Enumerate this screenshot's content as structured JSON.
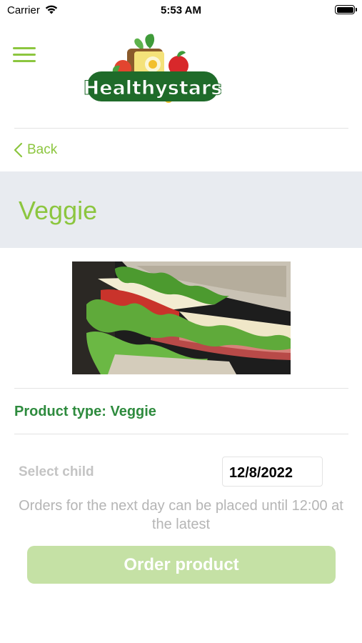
{
  "status_bar": {
    "carrier": "Carrier",
    "time": "5:53 AM"
  },
  "header": {
    "logo_text": "Healthystars"
  },
  "nav": {
    "back_label": "Back"
  },
  "page": {
    "title": "Veggie"
  },
  "product": {
    "type_label": "Product type: Veggie",
    "image_icon": "sandwich-photo"
  },
  "order_form": {
    "select_child_label": "Select child",
    "date_value": "12/8/2022",
    "notice": "Orders for the next day can be placed until 12:00 at the latest",
    "order_button_label": "Order product"
  },
  "colors": {
    "accent": "#8cc63f",
    "title_band": "#e8ebf0",
    "product_type": "#2e8b3e",
    "order_button_disabled": "#c5e1a5"
  }
}
